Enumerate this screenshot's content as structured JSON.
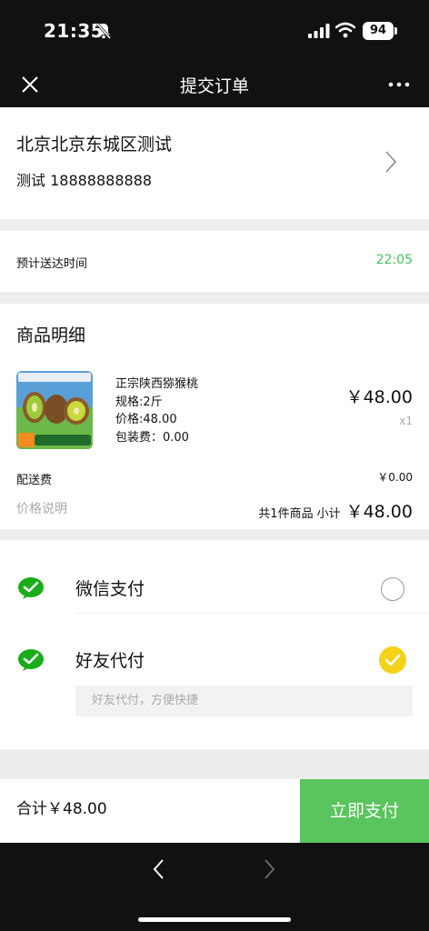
{
  "status_bar": {
    "time": "21:35",
    "battery": "94"
  },
  "nav": {
    "title": "提交订单"
  },
  "address": {
    "main": "北京北京东城区测试",
    "contact": "测试 18888888888"
  },
  "delivery": {
    "label": "预计送达时间",
    "time": "22:05"
  },
  "goods": {
    "title": "商品明细",
    "product": {
      "name": "正宗陕西猕猴桃",
      "spec": "规格:2斤",
      "price_line": "价格:48.00",
      "packing": "包装费：0.00",
      "price": "￥48.00",
      "qty": "x1"
    },
    "shipping_label": "配送费",
    "shipping_value": "￥0.00",
    "price_note": "价格说明",
    "subtotal_count": "共1件商品",
    "subtotal_label": "小计",
    "subtotal_value": "￥48.00"
  },
  "payment": {
    "wechat_label": "微信支付",
    "friend_label": "好友代付",
    "friend_hint": "好友代付，方便快捷",
    "selected": "好友代付"
  },
  "bottom": {
    "total": "合计￥48.00",
    "pay_button": "立即支付"
  },
  "colors": {
    "accent_green": "#5ac45d",
    "delivery_green": "#43c25f",
    "check_yellow": "#f4d217",
    "wechat_green": "#1aad19"
  }
}
